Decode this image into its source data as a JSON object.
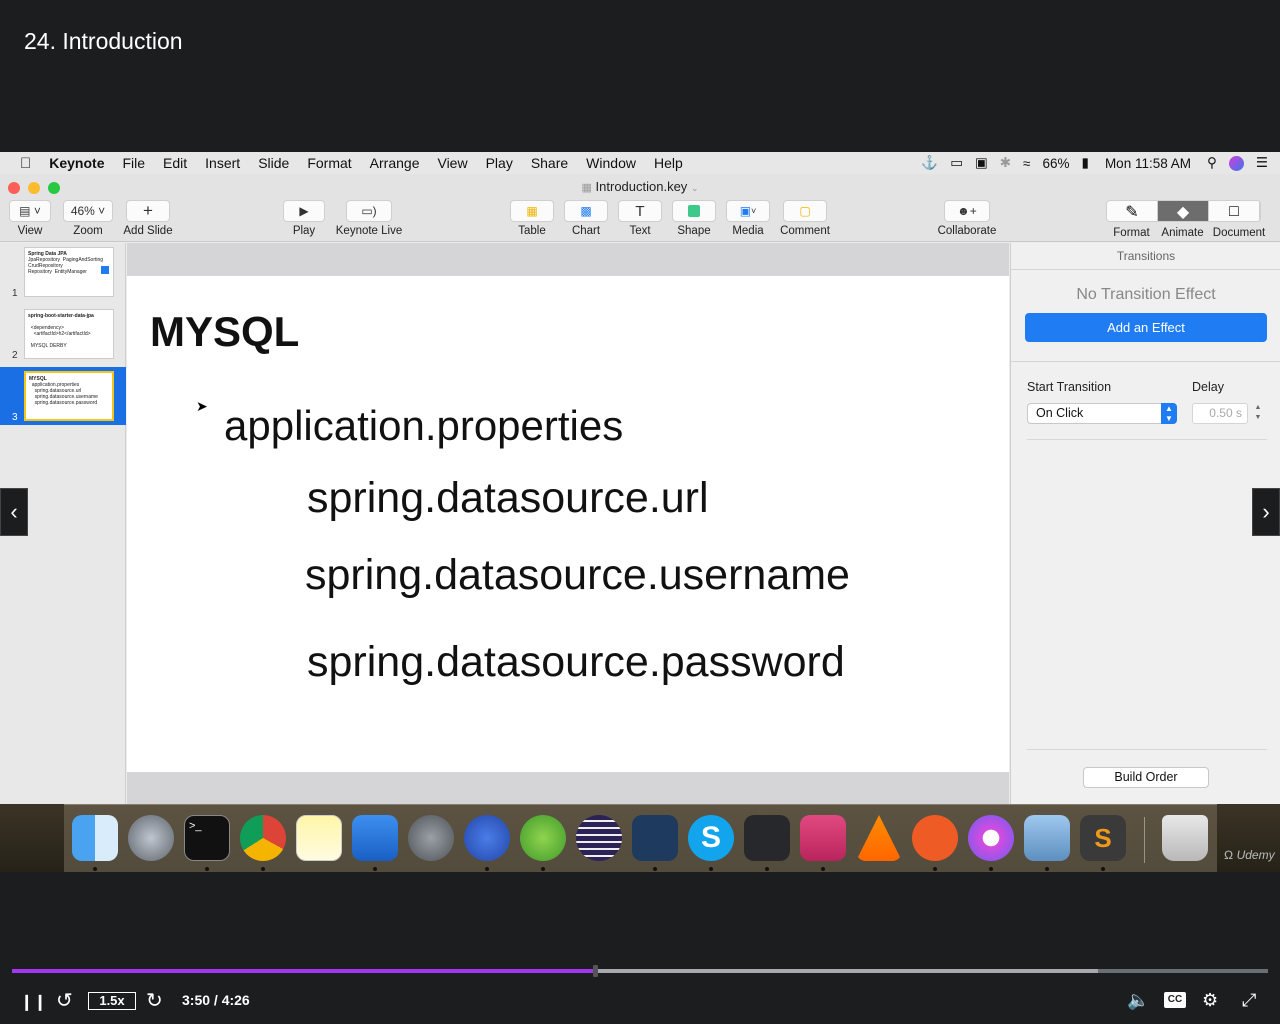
{
  "course": {
    "title": "24. Introduction"
  },
  "menubar": {
    "apple": "",
    "items": [
      "Keynote",
      "File",
      "Edit",
      "Insert",
      "Slide",
      "Format",
      "Arrange",
      "View",
      "Play",
      "Share",
      "Window",
      "Help"
    ],
    "battery": "66%",
    "clock": "Mon 11:58 AM"
  },
  "window": {
    "title": "Introduction.key"
  },
  "toolbar": {
    "view": "View",
    "zoom_value": "46%",
    "zoom": "Zoom",
    "add_slide": "Add Slide",
    "play": "Play",
    "keynote_live": "Keynote Live",
    "table": "Table",
    "chart": "Chart",
    "text": "Text",
    "shape": "Shape",
    "media": "Media",
    "comment": "Comment",
    "collaborate": "Collaborate",
    "format": "Format",
    "animate": "Animate",
    "document": "Document"
  },
  "navigator": {
    "slides": [
      {
        "num": "1",
        "title": "Spring Data JPA",
        "lines": [
          "JpaRepository",
          "PagingAndSorting",
          "CrudRepository",
          "Repository",
          "EntityManager"
        ]
      },
      {
        "num": "2",
        "title": "spring-boot-starter-data-jpa",
        "lines": [
          "<dependency>",
          "<artifactId>h2</artifactId>",
          "MYSQL    DERBY"
        ]
      },
      {
        "num": "3",
        "title": "MYSQL",
        "lines": [
          "application.properties",
          "spring.datasource.url",
          "spring.datasource.username",
          "spring.datasource.password"
        ]
      }
    ]
  },
  "slide": {
    "title": "MYSQL",
    "line1": "application.properties",
    "line2": "spring.datasource.url",
    "line3": "spring.datasource.username",
    "line4": "spring.datasource.password"
  },
  "inspector": {
    "header": "Transitions",
    "no_transition": "No Transition Effect",
    "add_effect": "Add an Effect",
    "start_label": "Start Transition",
    "start_value": "On Click",
    "delay_label": "Delay",
    "delay_value": "0.50 s",
    "build_order": "Build Order"
  },
  "dock": {
    "apps": [
      "finder-icon",
      "launchpad-icon",
      "terminal-icon",
      "chrome-icon",
      "notes-icon",
      "keynote-icon",
      "system-preferences-icon",
      "screen-recorder-icon",
      "spring-tool-suite-icon",
      "eclipse-icon",
      "mysql-workbench-icon",
      "skype-icon",
      "vscode-icon",
      "iterm-icon",
      "vlc-icon",
      "postman-icon",
      "itunes-icon",
      "preview-icon",
      "sublime-text-icon",
      "trash-icon"
    ],
    "watermark": "Udemy"
  },
  "player": {
    "speed": "1.5x",
    "time": "3:50 / 4:26",
    "progress": 0.464,
    "buffered": 0.865
  },
  "colors": {
    "accent": "#a435f0",
    "keynote_blue": "#1f7cf3"
  }
}
